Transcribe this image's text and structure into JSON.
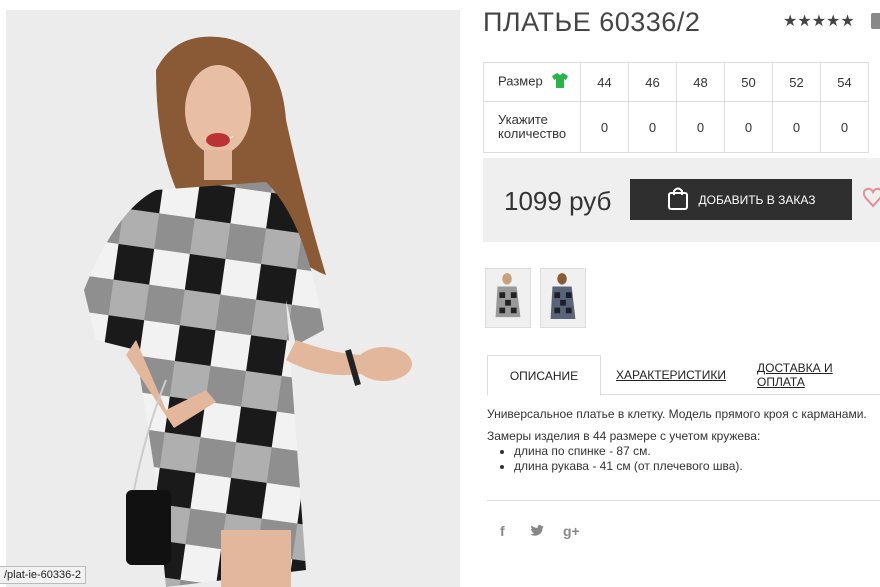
{
  "product": {
    "title": "ПЛАТЬЕ 60336/2",
    "rating": 5,
    "stars": "★★★★★",
    "price": "1099 руб",
    "add_to_order": "ДОБАВИТЬ В ЗАКАЗ"
  },
  "sizes": {
    "size_label": "Размер",
    "qty_label": "Укажите количество",
    "values": [
      "44",
      "46",
      "48",
      "50",
      "52",
      "54"
    ],
    "quantities": [
      "0",
      "0",
      "0",
      "0",
      "0",
      "0"
    ]
  },
  "tabs": {
    "description": "ОПИСАНИЕ",
    "specs": "ХАРАКТЕРИСТИКИ",
    "delivery": "ДОСТАВКА И ОПЛАТА"
  },
  "description": {
    "line1": "Универсальное платье в клетку. Модель прямого кроя с карманами.",
    "line2": "Замеры изделия в 44 размере с учетом кружева:",
    "items": [
      "длина по спинке - 87 см.",
      "длина рукава - 41 см (от плечевого шва)."
    ]
  },
  "social": {
    "facebook": "f",
    "twitter": "🐦",
    "googleplus": "g+"
  },
  "status_url": "/plat-ie-60336-2",
  "colors": {
    "accent_dark": "#2f2f2f",
    "icon_green": "#2bb34a",
    "heart_pink": "#e88b9a"
  }
}
